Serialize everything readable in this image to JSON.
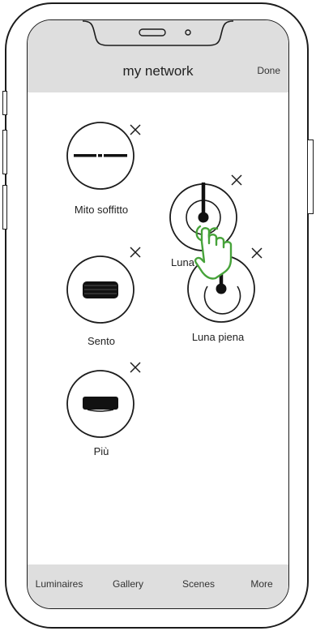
{
  "header": {
    "title": "my network",
    "done_label": "Done"
  },
  "fixtures": [
    {
      "label": "Mito soffitto"
    },
    {
      "label": "Luna"
    },
    {
      "label": "Sento"
    },
    {
      "label": "Luna piena"
    },
    {
      "label": "Più"
    }
  ],
  "tabbar": {
    "tabs": [
      "Luminaires",
      "Gallery",
      "Scenes",
      "More"
    ]
  },
  "colors": {
    "header_bg": "#dedede",
    "hand_accent": "#47a33a"
  }
}
